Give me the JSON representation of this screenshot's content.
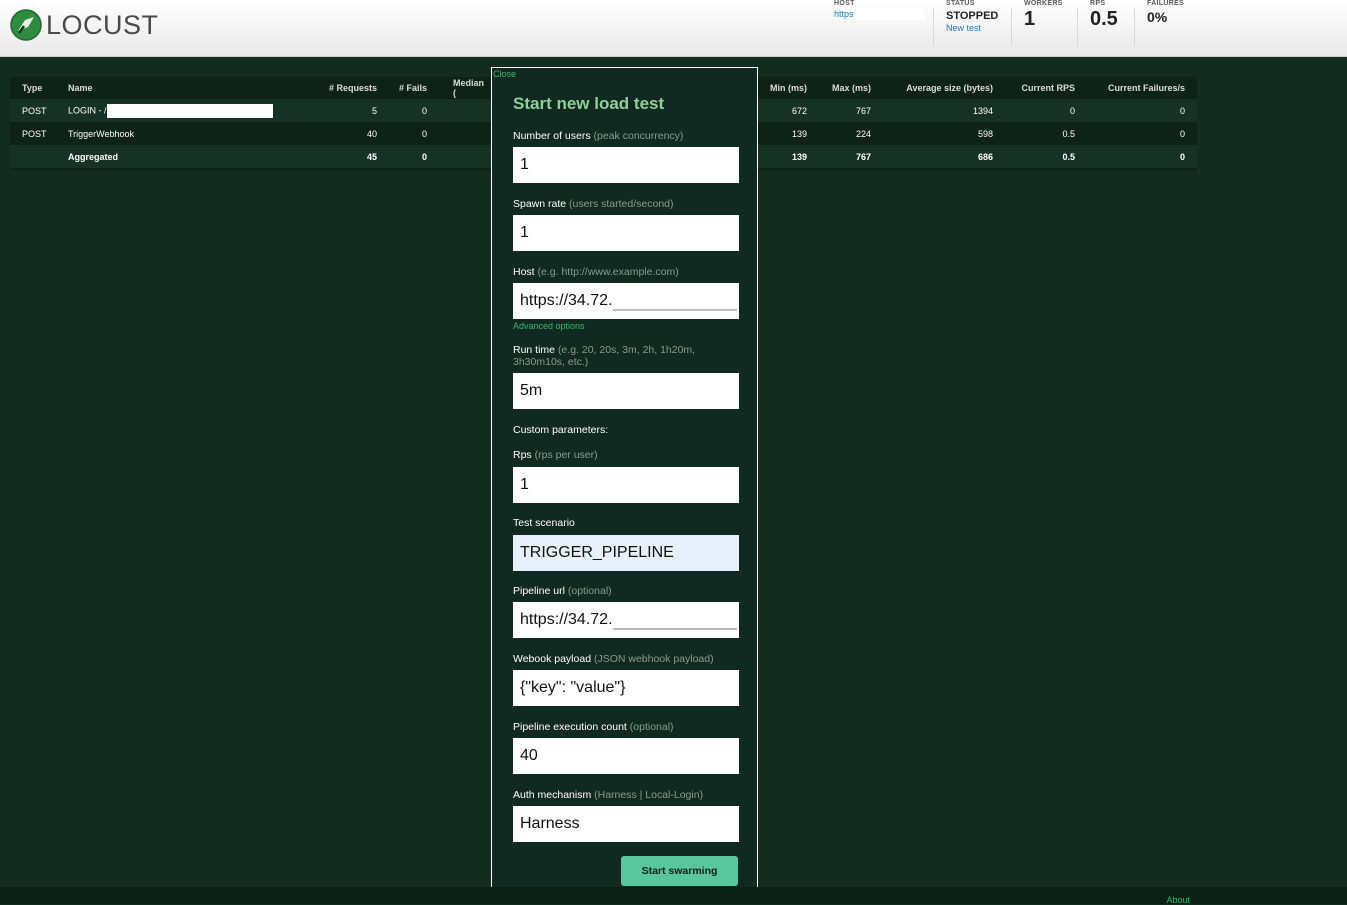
{
  "brand": {
    "name": "LOCUST"
  },
  "stats": {
    "host": {
      "label": "HOST",
      "value": "https"
    },
    "status": {
      "label": "STATUS",
      "value": "STOPPED",
      "link": "New test"
    },
    "workers": {
      "label": "WORKERS",
      "value": "1"
    },
    "rps": {
      "label": "RPS",
      "value": "0.5"
    },
    "failures": {
      "label": "FAILURES",
      "value": "0%"
    }
  },
  "table": {
    "headers": [
      "Type",
      "Name",
      "# Requests",
      "# Fails",
      "Median (",
      "Min (ms)",
      "Max (ms)",
      "Average size (bytes)",
      "Current RPS",
      "Current Failures/s"
    ],
    "rows": [
      {
        "type": "POST",
        "name": "LOGIN - /",
        "requests": "5",
        "fails": "0",
        "min": "672",
        "max": "767",
        "avg_size": "1394",
        "rps": "0",
        "failures": "0"
      },
      {
        "type": "POST",
        "name": "TriggerWebhook",
        "requests": "40",
        "fails": "0",
        "min": "139",
        "max": "224",
        "avg_size": "598",
        "rps": "0.5",
        "failures": "0"
      }
    ],
    "aggregated": {
      "type": "",
      "name": "Aggregated",
      "requests": "45",
      "fails": "0",
      "min": "139",
      "max": "767",
      "avg_size": "686",
      "rps": "0.5",
      "failures": "0"
    }
  },
  "modal": {
    "close": "Close",
    "title": "Start new load test",
    "users": {
      "label": "Number of users",
      "hint": "(peak concurrency)",
      "value": "1"
    },
    "spawn": {
      "label": "Spawn rate",
      "hint": "(users started/second)",
      "value": "1"
    },
    "host": {
      "label": "Host",
      "hint": "(e.g. http://www.example.com)",
      "value": "https://34.72."
    },
    "advanced": "Advanced options",
    "runtime": {
      "label": "Run time",
      "hint": "(e.g. 20, 20s, 3m, 2h, 1h20m, 3h30m10s, etc.)",
      "value": "5m"
    },
    "custom": "Custom parameters:",
    "rps": {
      "label": "Rps",
      "hint": "(rps per user)",
      "value": "1"
    },
    "scenario": {
      "label": "Test scenario",
      "value": "TRIGGER_PIPELINE"
    },
    "pipeline_url": {
      "label": "Pipeline url",
      "hint": "(optional)",
      "value": "https://34.72."
    },
    "payload": {
      "label": "Webook payload",
      "hint": "(JSON webhook payload)",
      "value": "{\"key\": \"value\"}"
    },
    "exec_count": {
      "label": "Pipeline execution count",
      "hint": "(optional)",
      "value": "40"
    },
    "auth": {
      "label": "Auth mechanism",
      "hint": "(Harness | Local-Login)",
      "value": "Harness"
    },
    "submit": "Start swarming"
  },
  "footer": {
    "about": "About"
  },
  "colors": {
    "background": "#132b21",
    "accent": "#3ab86e",
    "button": "#58c7a0",
    "title": "#8fcf9b"
  }
}
